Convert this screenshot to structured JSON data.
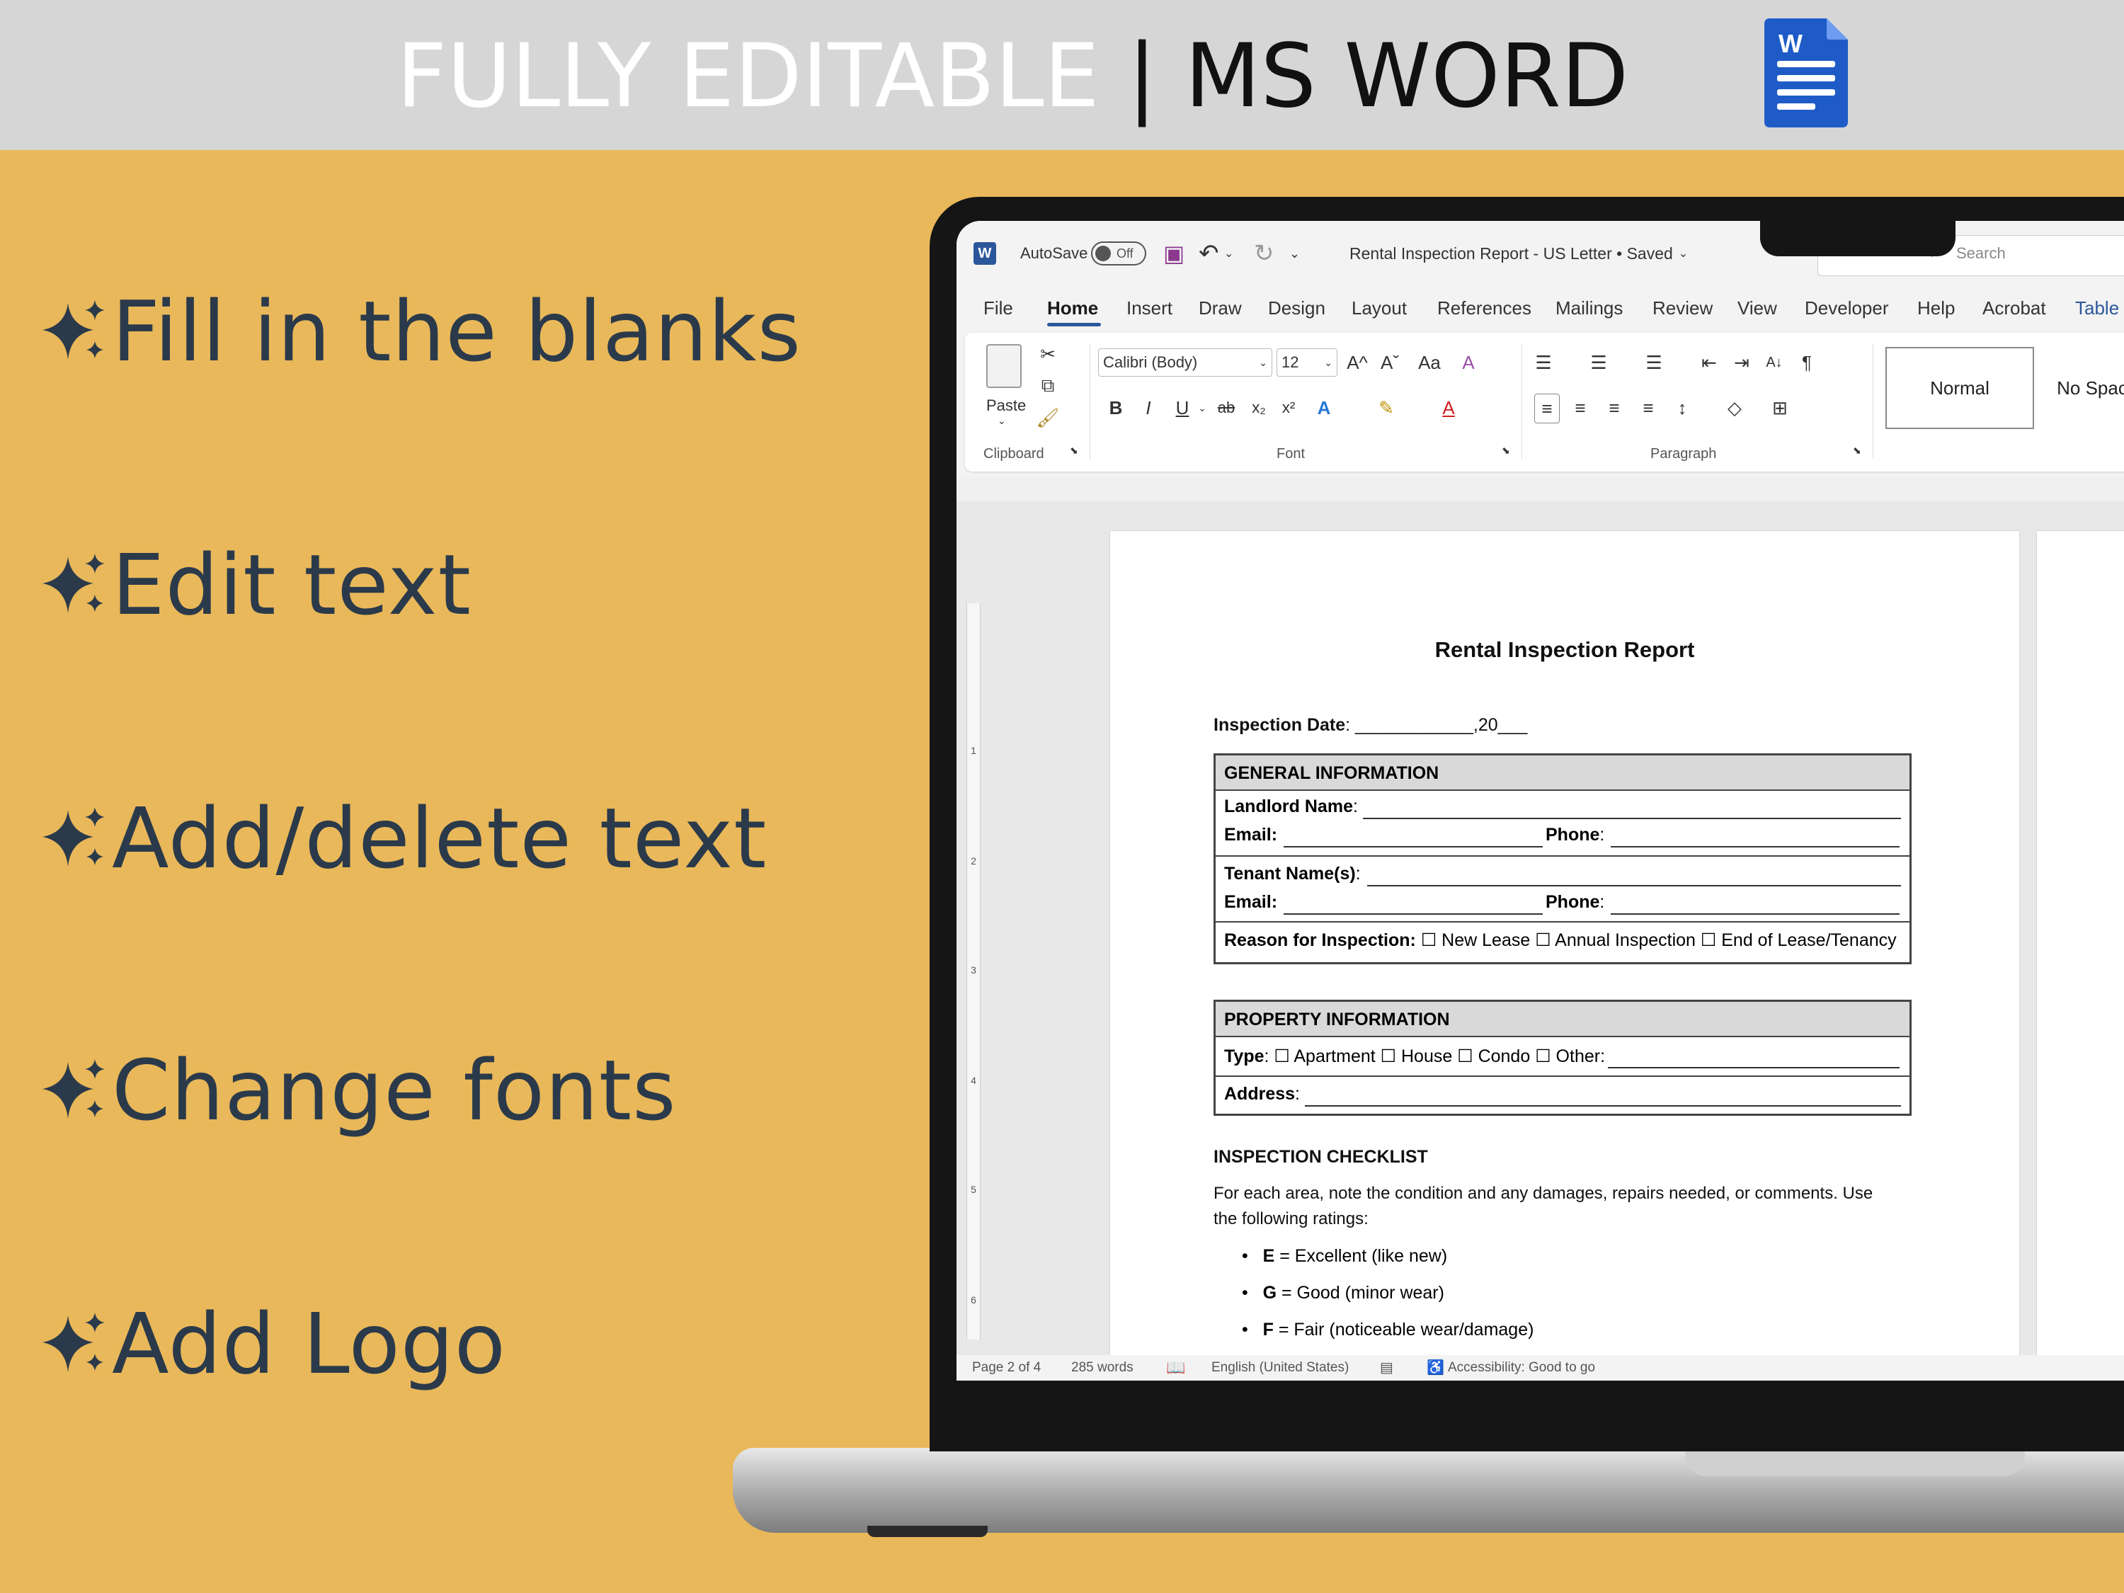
{
  "banner": {
    "text_light": "FULLY EDITABLE ",
    "separator": "| ",
    "text_dark": "MS WORD"
  },
  "features": [
    "Fill in the blanks",
    "Edit text",
    "Add/delete text",
    "Change fonts",
    "Add Logo"
  ],
  "colors": {
    "background": "#E9B85A",
    "banner": "#D6D6D6",
    "feature_text": "#2B3A4A",
    "word_blue": "#2B579A"
  },
  "titlebar": {
    "app_icon": "W",
    "autosave_label": "AutoSave",
    "autosave_state": "Off",
    "doc_title": "Rental Inspection Report - US Letter • Saved",
    "search_placeholder": "Search"
  },
  "menu": [
    "File",
    "Home",
    "Insert",
    "Draw",
    "Design",
    "Layout",
    "References",
    "Mailings",
    "Review",
    "View",
    "Developer",
    "Help",
    "Acrobat",
    "Table"
  ],
  "ribbon": {
    "paste": "Paste",
    "font_name": "Calibri (Body)",
    "font_size": "12",
    "grow": "A^",
    "shrink": "Aˇ",
    "change_case": "Aa",
    "bold": "B",
    "italic": "I",
    "underline": "U",
    "strike": "ab",
    "subscript": "x₂",
    "superscript": "x²",
    "pilcrow": "¶",
    "sort": "A↓",
    "groups": {
      "clipboard": "Clipboard",
      "font": "Font",
      "paragraph": "Paragraph"
    },
    "styles": [
      "Normal",
      "No Spac"
    ]
  },
  "document": {
    "title": "Rental Inspection Report",
    "inspection_date_label": "Inspection Date",
    "inspection_date_rest": ": ____________,20___",
    "general": {
      "header": "GENERAL INFORMATION",
      "landlord": "Landlord Name",
      "email": "Email:",
      "phone": "Phone",
      "tenant": "Tenant Name(s)",
      "reason_label": "Reason for Inspection:",
      "reason_options": "☐ New Lease  ☐ Annual Inspection ☐ End of Lease/Tenancy"
    },
    "property": {
      "header": "PROPERTY INFORMATION",
      "type_label": "Type",
      "type_options": ": ☐ Apartment ☐ House ☐ Condo ☐ Other:",
      "address_label": "Address"
    },
    "checklist": {
      "header": "INSPECTION CHECKLIST",
      "intro_1": "For each area, note the condition and any damages, repairs needed, or comments. Use",
      "intro_2": "the following ratings:",
      "ratings": [
        {
          "key": "E",
          "text": " = Excellent (like new)"
        },
        {
          "key": "G",
          "text": " = Good (minor wear)"
        },
        {
          "key": "F",
          "text": " = Fair (noticeable wear/damage)"
        }
      ]
    }
  },
  "ruler_numbers": [
    "1",
    "2",
    "3",
    "4",
    "5",
    "6"
  ],
  "status": {
    "page": "Page 2 of 4",
    "words": "285 words",
    "language": "English (United States)",
    "accessibility": "Accessibility: Good to go"
  }
}
